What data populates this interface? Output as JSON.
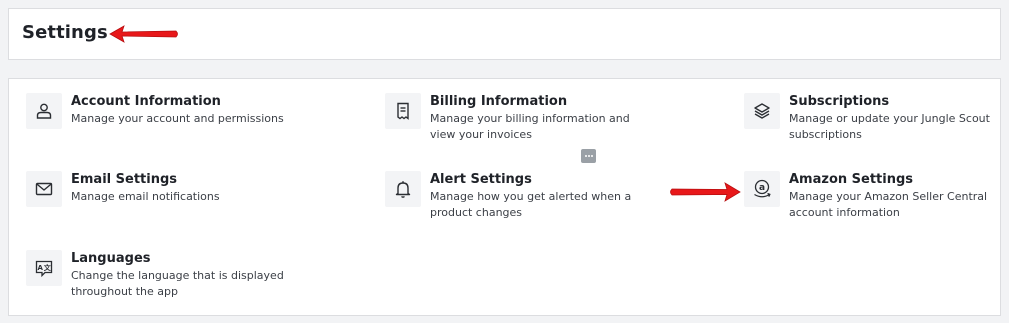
{
  "header": {
    "title": "Settings"
  },
  "items": [
    {
      "title": "Account Information",
      "description": "Manage your account and permissions",
      "icon": "user-icon"
    },
    {
      "title": "Billing Information",
      "description": "Manage your billing information and view your invoices",
      "icon": "receipt-icon"
    },
    {
      "title": "Subscriptions",
      "description": "Manage or update your Jungle Scout subscriptions",
      "icon": "layers-icon"
    },
    {
      "title": "Email Settings",
      "description": "Manage email notifications",
      "icon": "envelope-icon"
    },
    {
      "title": "Alert Settings",
      "description": "Manage how you get alerted when a product changes",
      "icon": "bell-icon"
    },
    {
      "title": "Amazon Settings",
      "description": "Manage your Amazon Seller Central account information",
      "icon": "amazon-logo-icon"
    },
    {
      "title": "Languages",
      "description": "Change the language that is displayed throughout the app",
      "icon": "translate-icon"
    }
  ],
  "colors": {
    "arrow": "#e8181a",
    "icon_bg": "#f3f4f6",
    "text_primary": "#1f2228"
  }
}
